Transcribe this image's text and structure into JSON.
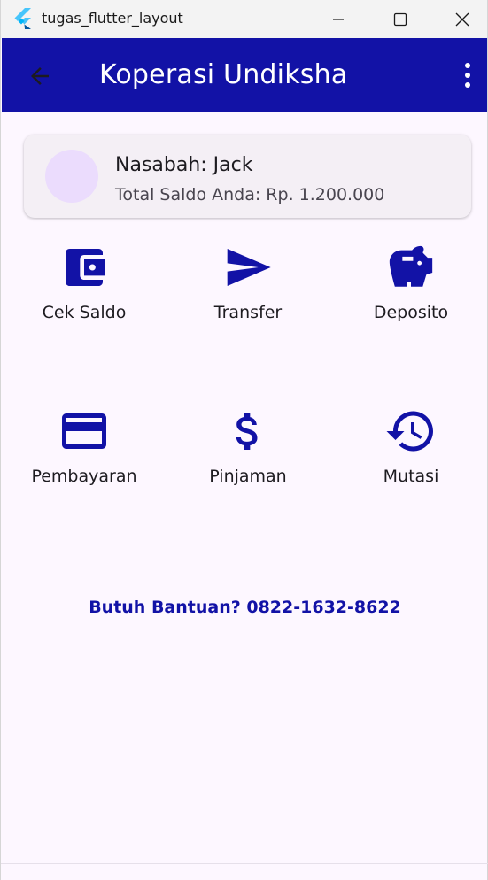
{
  "window": {
    "title": "tugas_flutter_layout",
    "icons": [
      "flutter-logo-icon",
      "minimize-icon",
      "maximize-icon",
      "close-icon"
    ]
  },
  "appbar": {
    "title": "Koperasi Undiksha",
    "background": "#1212a6",
    "icons": [
      "back-arrow-icon",
      "more-vert-icon"
    ]
  },
  "account": {
    "name_line": "Nasabah: Jack",
    "balance_line": "Total Saldo Anda: Rp. 1.200.000",
    "avatar_color": "#ebdcfd"
  },
  "menu": [
    {
      "label": "Cek Saldo",
      "icon": "wallet-icon"
    },
    {
      "label": "Transfer",
      "icon": "send-icon"
    },
    {
      "label": "Deposito",
      "icon": "piggy-bank-icon"
    },
    {
      "label": "Pembayaran",
      "icon": "credit-card-icon"
    },
    {
      "label": "Pinjaman",
      "icon": "dollar-icon"
    },
    {
      "label": "Mutasi",
      "icon": "history-icon"
    }
  ],
  "help": {
    "text": "Butuh Bantuan? 0822-1632-8622"
  },
  "colors": {
    "primary": "#1212a6",
    "page_background": "#fdf7ff",
    "card_background": "#f4eff5"
  }
}
